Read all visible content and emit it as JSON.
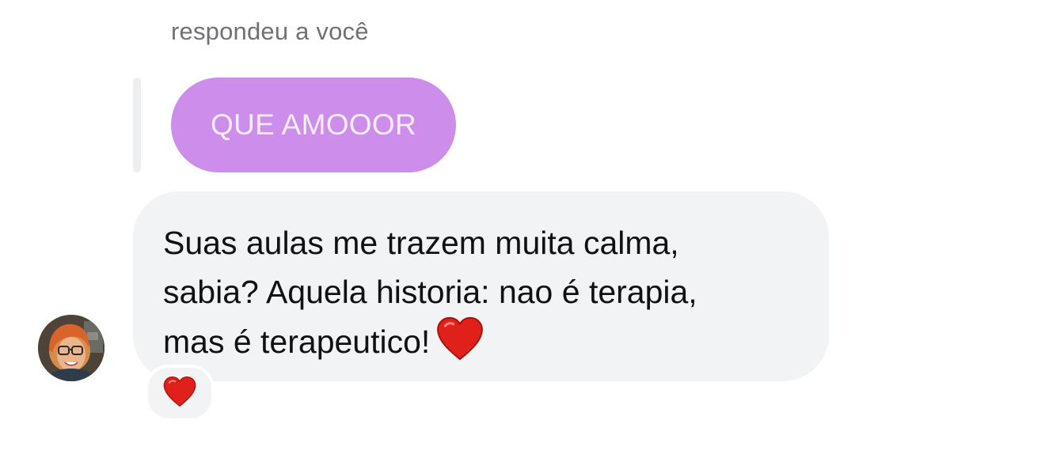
{
  "reply": {
    "label": "respondeu a você"
  },
  "quoted_message": {
    "text": "QUE AMOOOR",
    "bubble_color": "#cc8deb"
  },
  "message": {
    "text": "Suas aulas me trazem muita calma,\nsabia? Aquela historia: nao é terapia,\nmas é terapeutico!",
    "trailing_emoji": "red-heart-icon",
    "bubble_color": "#f2f3f5"
  },
  "reaction": {
    "emoji": "red-heart-icon"
  },
  "sender": {
    "avatar": "avatar"
  }
}
